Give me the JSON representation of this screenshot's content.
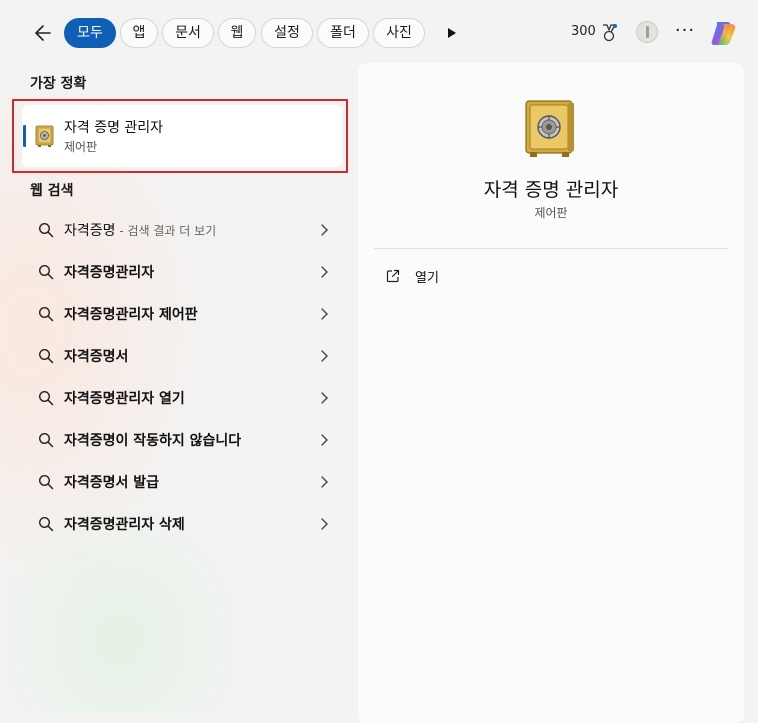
{
  "tabs": [
    {
      "label": "모두",
      "active": true
    },
    {
      "label": "앱",
      "active": false
    },
    {
      "label": "문서",
      "active": false
    },
    {
      "label": "웹",
      "active": false
    },
    {
      "label": "설정",
      "active": false
    },
    {
      "label": "폴더",
      "active": false
    },
    {
      "label": "사진",
      "active": false
    }
  ],
  "header": {
    "points": "300"
  },
  "best_match": {
    "section_label": "가장 정확",
    "title": "자격 증명 관리자",
    "subtitle": "제어판",
    "icon": "safe-icon"
  },
  "web_search": {
    "section_label": "웹 검색",
    "items": [
      {
        "text": "자격증명",
        "hint": " - 검색 결과 더 보기",
        "bold": false
      },
      {
        "text": "자격증명관리자",
        "hint": "",
        "bold": true
      },
      {
        "text": "자격증명관리자 제어판",
        "hint": "",
        "bold": true
      },
      {
        "text": "자격증명서",
        "hint": "",
        "bold": true
      },
      {
        "text": "자격증명관리자 열기",
        "hint": "",
        "bold": true
      },
      {
        "text": "자격증명이 작동하지 않습니다",
        "hint": "",
        "bold": true
      },
      {
        "text": "자격증명서 발급",
        "hint": "",
        "bold": true
      },
      {
        "text": "자격증명관리자 삭제",
        "hint": "",
        "bold": true
      }
    ]
  },
  "detail": {
    "title": "자격 증명 관리자",
    "subtitle": "제어판",
    "actions": [
      {
        "label": "열기",
        "icon": "open-external-icon"
      }
    ]
  },
  "colors": {
    "accent": "#0f5fb7",
    "highlight_box": "#d42a2a"
  }
}
